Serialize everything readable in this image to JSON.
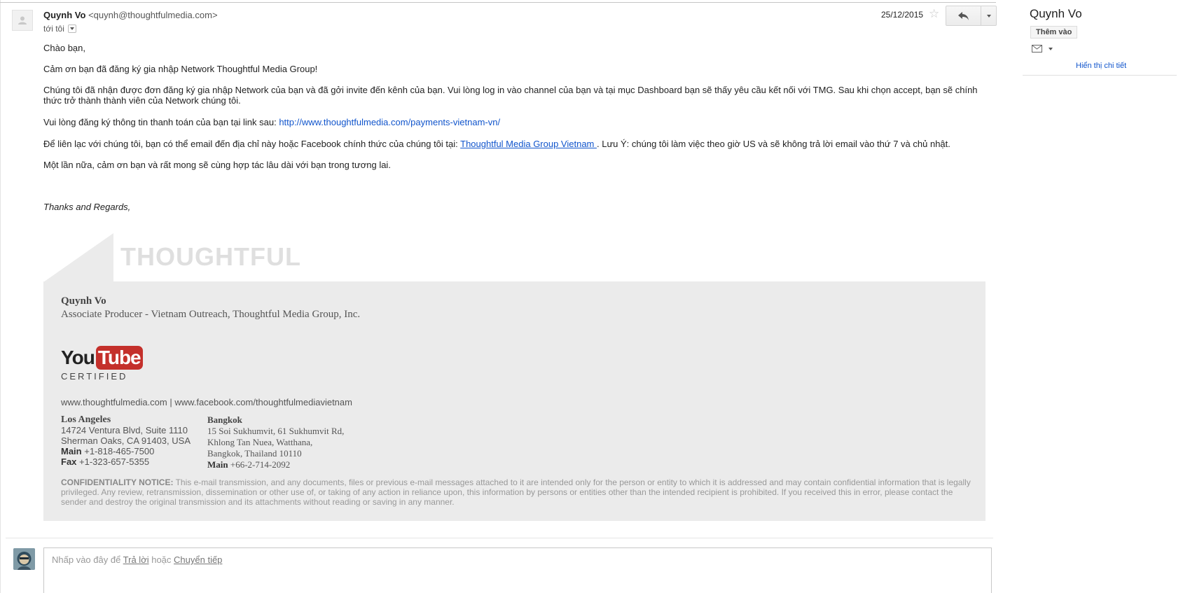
{
  "header": {
    "sender_name": "Quynh Vo",
    "sender_email": "<quynh@thoughtfulmedia.com>",
    "to_label": "tới tôi",
    "date": "25/12/2015"
  },
  "body": {
    "greeting": "Chào bạn,",
    "thanks": "Cảm ơn bạn đã đăng ký gia nhập Network Thoughtful Media Group!",
    "received": "Chúng tôi đã nhận được đơn đăng ký gia nhập Network của bạn và đã gởi invite đến kênh của bạn. Vui lòng log in vào channel của bạn và tại mục Dashboard bạn sẽ thấy yêu cầu kết nối với TMG. Sau khi chọn accept, bạn sẽ chính thức trở thành thành viên của Network chúng tôi.",
    "payment_prefix": "Vui lòng đăng ký thông tin thanh toán của bạn tại link sau: ",
    "payment_link": "http://www.thoughtfulmedia.com/payments-vietnam-vn/",
    "contact_prefix": "Để liên lạc với chúng tôi, bạn có thể email đến địa chỉ này hoặc Facebook chính thức của chúng tôi tại: ",
    "contact_link": "Thoughtful Media Group Vietnam ",
    "contact_suffix": ". Lưu Ý: chúng tôi làm việc theo giờ US và sẽ không trả lời email vào thứ 7 và chủ nhật.",
    "closing": "Một lần nữa, cảm ơn bạn và rất mong sẽ cùng hợp tác lâu dài với bạn trong tương lai.",
    "regards": "Thanks and Regards,"
  },
  "signature": {
    "brand": "THOUGHTFUL",
    "name": "Quynh Vo",
    "title": "Associate Producer - Vietnam Outreach, Thoughtful Media Group, Inc.",
    "yt_you": "You",
    "yt_tube": "Tube",
    "yt_certified": "CERTIFIED",
    "web": "www.thoughtfulmedia.com | www.facebook.com/thoughtfulmediavietnam",
    "la_city": "Los Angeles",
    "la_line1": "14724 Ventura Blvd, Suite 1110",
    "la_line2": "Sherman Oaks, CA 91403, USA",
    "la_main_label": "Main",
    "la_main": " +1-818-465-7500",
    "la_fax_label": "Fax",
    "la_fax": " +1-323-657-5355",
    "bk_city": "Bangkok",
    "bk_line1": "15 Soi Sukhumvit, 61 Sukhumvit Rd,",
    "bk_line2": "Khlong Tan Nuea, Watthana,",
    "bk_line3": "Bangkok, Thailand 10110",
    "bk_main_label": "Main",
    "bk_main": " +66-2-714-2092",
    "conf_label": "CONFIDENTIALITY NOTICE:",
    "conf_text": " This e-mail transmission, and any documents, files or previous e-mail messages attached to it are intended only for the person or entity to which it is addressed and may contain confidential information that is legally privileged. Any review, retransmission, dissemination or other use of, or taking of any action in reliance upon, this information by persons or entities other than the intended recipient is prohibited. If you received this in error, please contact the sender and destroy the original transmission and its attachments without reading or saving in any manner."
  },
  "reply": {
    "prefix": "Nhấp vào đây để ",
    "reply_link": "Trả lời",
    "middle": " hoặc ",
    "forward_link": "Chuyển tiếp"
  },
  "right_panel": {
    "name": "Quynh Vo",
    "add_button": "Thêm vào",
    "details_link": "Hiển thị chi tiết"
  },
  "icons": {
    "avatar": "default-person-icon",
    "star": "star-outline-icon",
    "reply": "reply-arrow-icon",
    "more": "caret-down-icon",
    "mail": "envelope-icon"
  },
  "colors": {
    "link": "#1155cc",
    "signature_bg": "#ebebeb",
    "youtube_red": "#c4302b"
  }
}
